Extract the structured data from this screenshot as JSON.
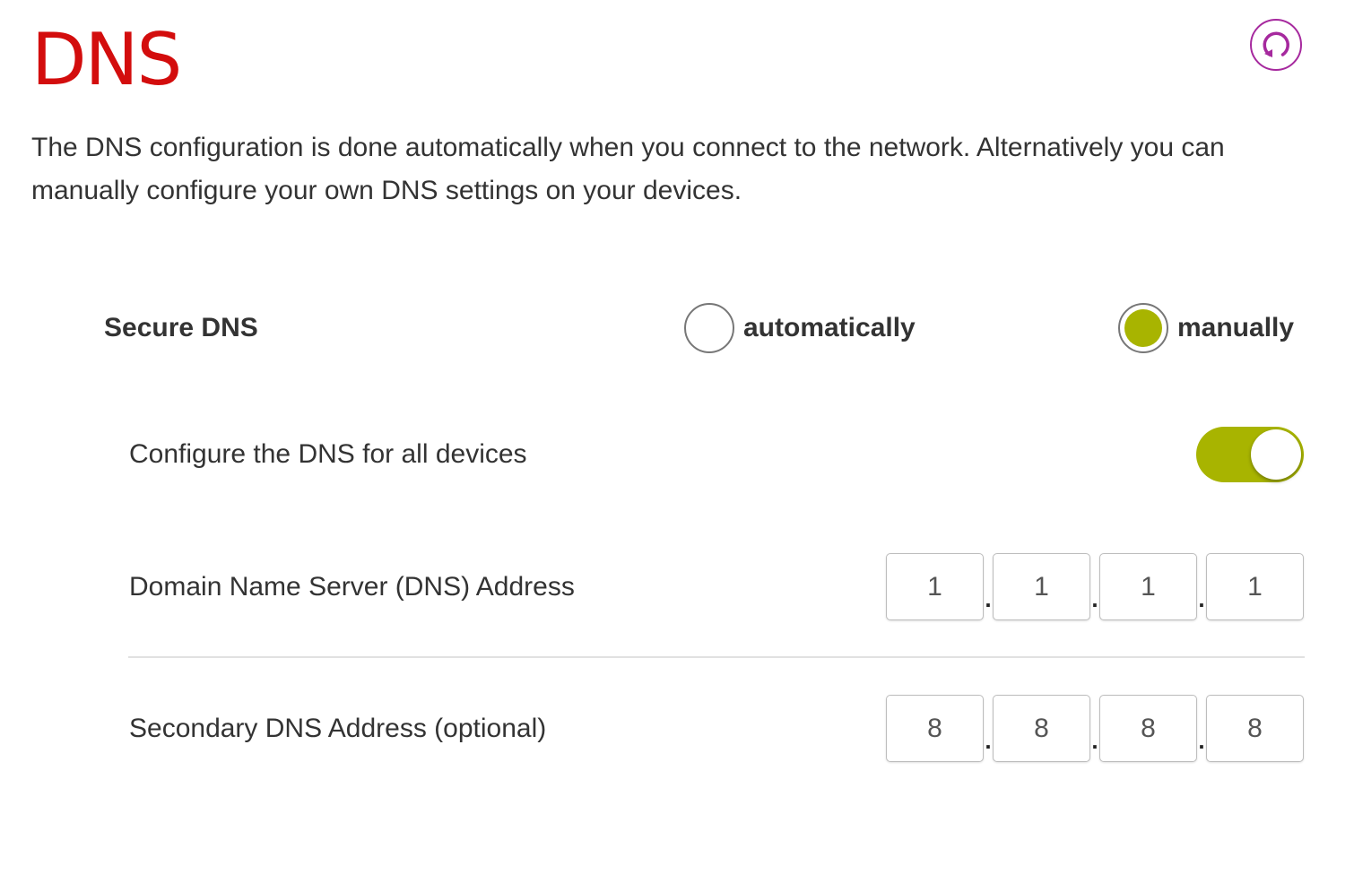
{
  "page": {
    "title": "DNS",
    "description": "The DNS configuration is done automatically when you connect to the network. Alternatively you can manually configure your own DNS settings on your devices."
  },
  "colors": {
    "title": "#d30d0d",
    "accent": "#a8b400",
    "refresh": "#a6299e"
  },
  "icons": {
    "refresh": "refresh-icon"
  },
  "secure_dns": {
    "label": "Secure DNS",
    "options": [
      {
        "label": "automatically",
        "selected": false
      },
      {
        "label": "manually",
        "selected": true
      }
    ]
  },
  "configure_all": {
    "label": "Configure the DNS for all devices",
    "enabled": true
  },
  "primary_dns": {
    "label": "Domain Name Server (DNS) Address",
    "octets": [
      "1",
      "1",
      "1",
      "1"
    ]
  },
  "secondary_dns": {
    "label": "Secondary DNS Address (optional)",
    "octets": [
      "8",
      "8",
      "8",
      "8"
    ]
  },
  "ip_separator": "."
}
